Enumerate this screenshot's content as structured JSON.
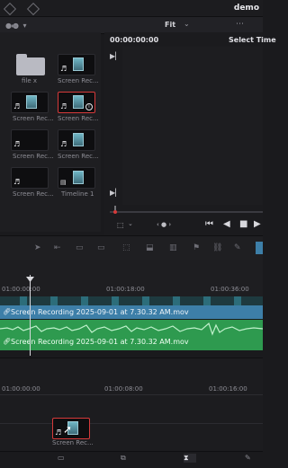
{
  "project_name": "demo",
  "viewer": {
    "fit_label": "Fit",
    "timecode": "00:00:00:00",
    "selected_timeline_label": "Select Time"
  },
  "media_pool": {
    "items": [
      {
        "label": "file x",
        "type": "folder"
      },
      {
        "label": "Screen Rec...",
        "type": "video"
      },
      {
        "label": "Screen Rec...",
        "type": "video"
      },
      {
        "label": "Screen Rec...",
        "type": "video",
        "selected": true
      },
      {
        "label": "Screen Rec...",
        "type": "audio"
      },
      {
        "label": "Screen Rec...",
        "type": "video"
      },
      {
        "label": "Screen Rec...",
        "type": "audio"
      },
      {
        "label": "Timeline 1",
        "type": "timeline"
      }
    ]
  },
  "timeline": {
    "ruler_top": [
      "01:00:00:00",
      "01:00:18:00",
      "01:00:36:00"
    ],
    "clip_video": "Screen Recording 2025-09-01 at 7.30.32 AM.mov",
    "clip_audio": "Screen Recording 2025-09-01 at 7.30.32 AM.mov",
    "ruler_lower": [
      "01:00:00:00",
      "01:00:08:00",
      "01:00:16:00"
    ]
  },
  "drag_clip_label": "Screen Rec...",
  "colors": {
    "video_track": "#3d7fa8",
    "audio_track": "#2e9a4f",
    "selection": "#d63a3a"
  },
  "icons": [
    "diamond-icon",
    "play-marker-icon",
    "skip-start-icon",
    "step-back-icon",
    "stop-icon",
    "play-icon",
    "cursor-icon",
    "link-icon",
    "music-note-icon",
    "info-icon",
    "folder-icon"
  ]
}
